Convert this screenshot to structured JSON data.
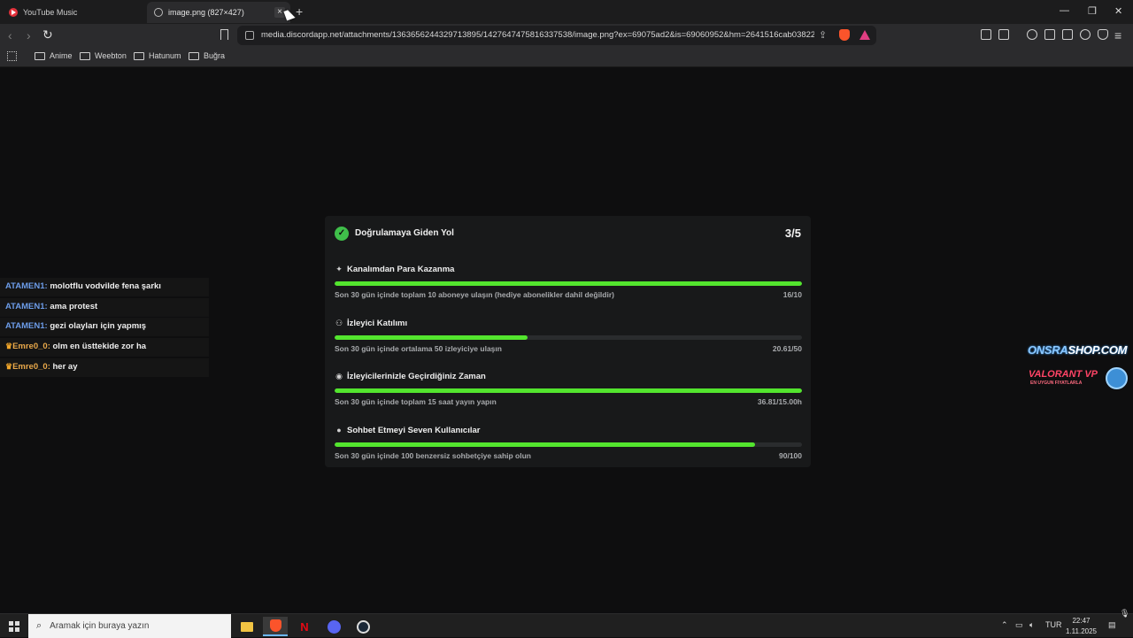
{
  "browser": {
    "tabs": [
      {
        "label": "YouTube Music",
        "icon": "youtube-music-icon",
        "active": false
      },
      {
        "label": "image.png (827×427)",
        "icon": "globe-icon",
        "active": true
      }
    ],
    "new_tab": "+",
    "window_controls": {
      "minimize": "—",
      "maximize": "❐",
      "close": "✕"
    },
    "url": "media.discordapp.net/attachments/1363656244329713895/1427647475816337538/image.png?ex=69075ad2&is=69060952&hm=2641516cab03822...",
    "bookmarks": [
      "Anime",
      "Weebton",
      "Hatunum",
      "Buğra"
    ]
  },
  "card": {
    "title": "Doğrulamaya Giden Yol",
    "progress": "3/5",
    "sections": [
      {
        "icon": "sparkle-icon",
        "title": "Kanalımdan Para Kazanma",
        "desc": "Son 30 gün içinde toplam 10 aboneye ulaşın (hediye abonelikler dahil değildir)",
        "value": "16/10",
        "fill": 1.0
      },
      {
        "icon": "users-icon",
        "title": "İzleyici Katılımı",
        "desc": "Son 30 gün içinde ortalama 50 izleyiciye ulaşın",
        "value": "20.61/50",
        "fill": 0.412
      },
      {
        "icon": "broadcast-icon",
        "title": "İzleyicilerinizle Geçirdiğiniz Zaman",
        "desc": "Son 30 gün içinde toplam 15 saat yayın yapın",
        "value": "36.81/15.00h",
        "fill": 1.0
      },
      {
        "icon": "chat-bubble-icon",
        "title": "Sohbet Etmeyi Seven Kullanıcılar",
        "desc": "Son 30 gün içinde 100 benzersiz sohbetçiye sahip olun",
        "value": "90/100",
        "fill": 0.9
      }
    ]
  },
  "chat": [
    {
      "user": "ATAMEN1:",
      "msg": "molotflu vodvilde fena şarkı",
      "crown": false
    },
    {
      "user": "ATAMEN1:",
      "msg": "ama protest",
      "crown": false
    },
    {
      "user": "ATAMEN1:",
      "msg": "gezi olayları için yapmış",
      "crown": false
    },
    {
      "user": "Emre0_0:",
      "msg": "olm en üsttekide zor ha",
      "crown": true
    },
    {
      "user": "Emre0_0:",
      "msg": "her ay",
      "crown": true
    }
  ],
  "promo": {
    "title_a": "ONSRA",
    "title_b": "SHOP.COM",
    "sub": "VALORANT VP",
    "sub2": "EN UYGUN FIYATLARLA"
  },
  "taskbar": {
    "search_placeholder": "Aramak için buraya yazın",
    "language": "TUR",
    "time": "22:47",
    "date": "1.11.2025"
  }
}
